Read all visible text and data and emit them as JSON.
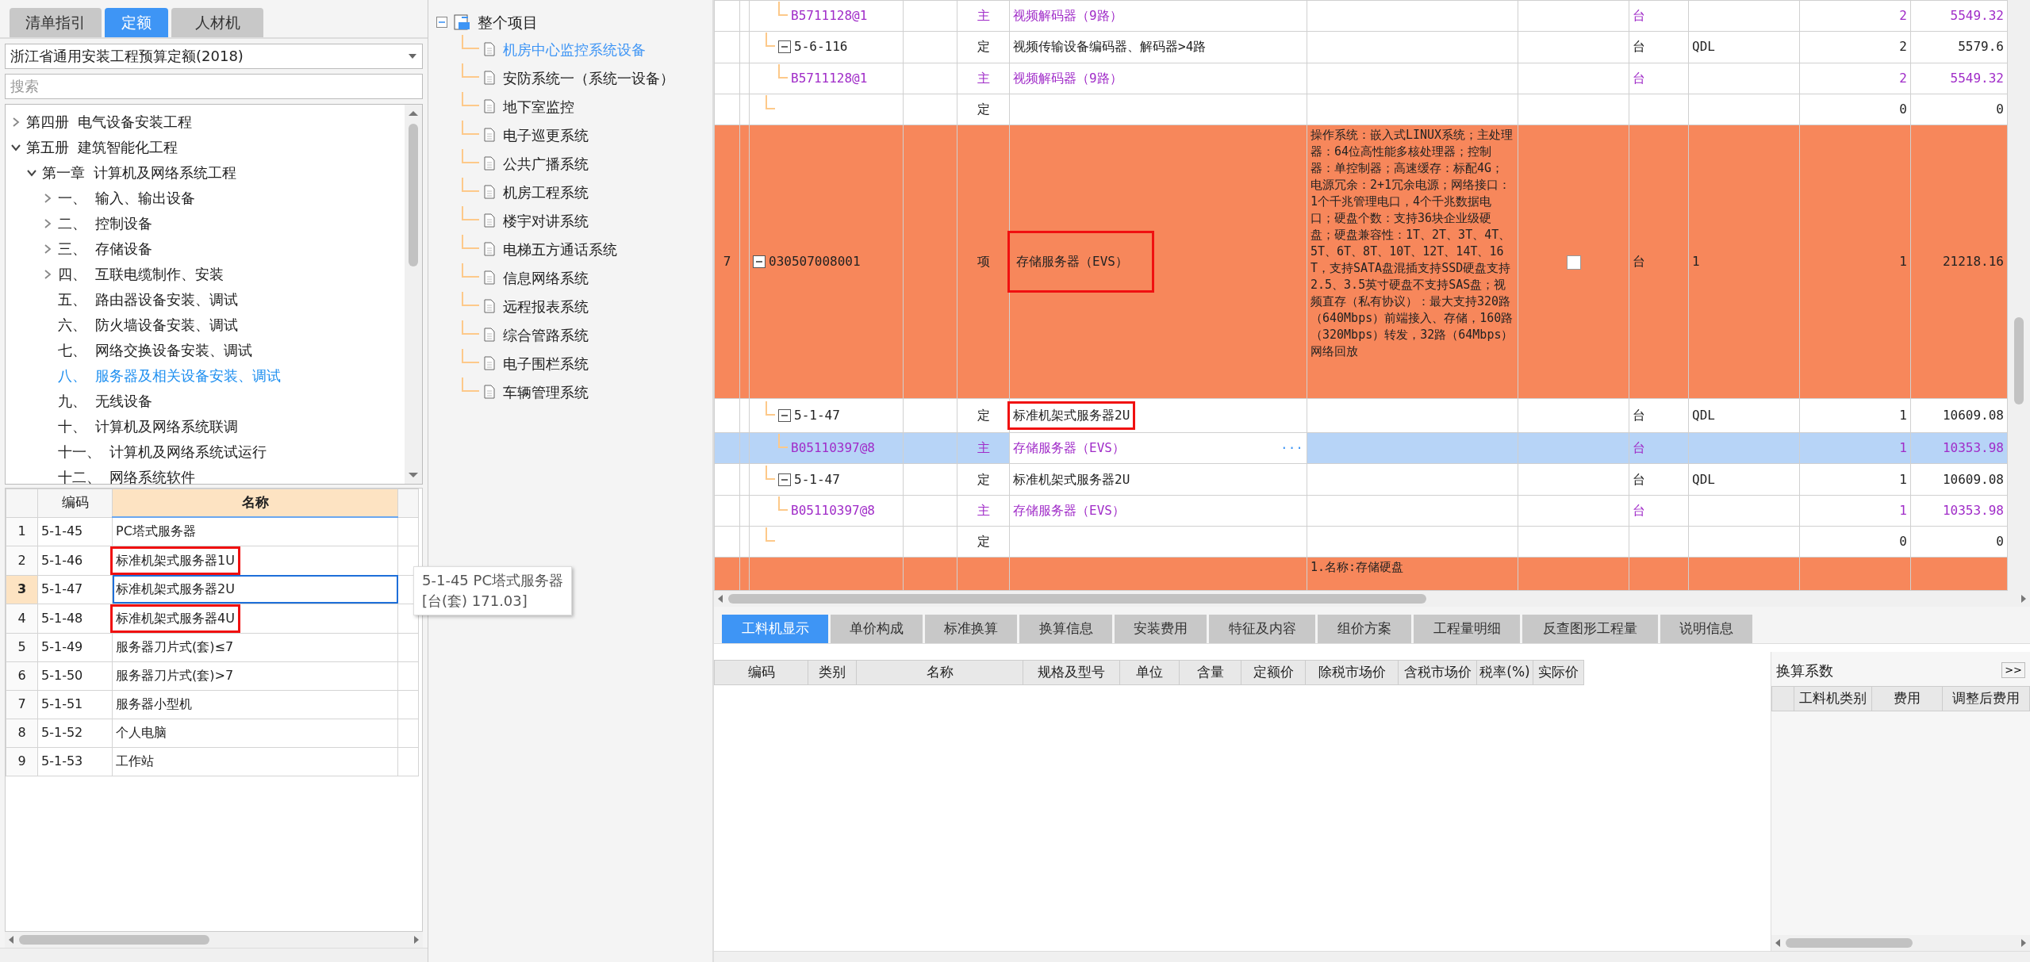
{
  "left_tabs": [
    {
      "label": "清单指引",
      "selected": false
    },
    {
      "label": "定额",
      "selected": true
    },
    {
      "label": "人材机",
      "selected": false
    }
  ],
  "quota_library": {
    "value": "浙江省通用安装工程预算定额(2018)"
  },
  "search": {
    "placeholder": "搜索"
  },
  "chapter_tree": [
    {
      "label": "第四册  电气设备安装工程",
      "kind": "group",
      "expanded": false,
      "selected": false
    },
    {
      "label": "第五册  建筑智能化工程",
      "kind": "group",
      "expanded": true,
      "selected": false,
      "children": [
        {
          "label": "第一章  计算机及网络系统工程",
          "kind": "group",
          "expanded": true,
          "selected": false,
          "children": [
            {
              "label": "一、  输入、输出设备",
              "kind": "group",
              "expanded": false,
              "selected": false
            },
            {
              "label": "二、  控制设备",
              "kind": "group",
              "expanded": false,
              "selected": false
            },
            {
              "label": "三、  存储设备",
              "kind": "group",
              "expanded": false,
              "selected": false
            },
            {
              "label": "四、  互联电缆制作、安装",
              "kind": "group",
              "expanded": false,
              "selected": false
            },
            {
              "label": "五、  路由器设备安装、调试",
              "kind": "leaf",
              "selected": false
            },
            {
              "label": "六、  防火墙设备安装、调试",
              "kind": "leaf",
              "selected": false
            },
            {
              "label": "七、  网络交换设备安装、调试",
              "kind": "leaf",
              "selected": false
            },
            {
              "label": "八、  服务器及相关设备安装、调试",
              "kind": "leaf",
              "selected": true
            },
            {
              "label": "九、  无线设备",
              "kind": "leaf",
              "selected": false
            },
            {
              "label": "十、  计算机及网络系统联调",
              "kind": "leaf",
              "selected": false
            },
            {
              "label": "十一、  计算机及网络系统试运行",
              "kind": "leaf",
              "selected": false
            },
            {
              "label": "十二、  网络系统软件",
              "kind": "leaf",
              "selected": false
            }
          ]
        }
      ]
    }
  ],
  "quota_grid": {
    "columns": [
      {
        "label": "编码",
        "selected": false
      },
      {
        "label": "名称",
        "selected": true
      }
    ],
    "rows": [
      {
        "no": "1",
        "code": "5-1-45",
        "name": "PC塔式服务器",
        "selected": false,
        "marked": false
      },
      {
        "no": "2",
        "code": "5-1-46",
        "name": "标准机架式服务器1U",
        "selected": false,
        "marked": true
      },
      {
        "no": "3",
        "code": "5-1-47",
        "name": "标准机架式服务器2U",
        "selected": true,
        "marked": false
      },
      {
        "no": "4",
        "code": "5-1-48",
        "name": "标准机架式服务器4U",
        "selected": false,
        "marked": true
      },
      {
        "no": "5",
        "code": "5-1-49",
        "name": "服务器刀片式(套)≤7",
        "selected": false,
        "marked": false
      },
      {
        "no": "6",
        "code": "5-1-50",
        "name": "服务器刀片式(套)>7",
        "selected": false,
        "marked": false
      },
      {
        "no": "7",
        "code": "5-1-51",
        "name": "服务器小型机",
        "selected": false,
        "marked": false
      },
      {
        "no": "8",
        "code": "5-1-52",
        "name": "个人电脑",
        "selected": false,
        "marked": false
      },
      {
        "no": "9",
        "code": "5-1-53",
        "name": "工作站",
        "selected": false,
        "marked": false
      }
    ]
  },
  "tooltip": {
    "lines": [
      "5-1-45 PC塔式服务器",
      "[台(套) 171.03]"
    ]
  },
  "project_tree": {
    "label": "整个项目",
    "expanded": true,
    "children": [
      {
        "label": "机房中心监控系统设备",
        "selected": true
      },
      {
        "label": "安防系统一（系统一设备）",
        "selected": false
      },
      {
        "label": "地下室监控",
        "selected": false
      },
      {
        "label": "电子巡更系统",
        "selected": false
      },
      {
        "label": "公共广播系统",
        "selected": false
      },
      {
        "label": "机房工程系统",
        "selected": false
      },
      {
        "label": "楼宇对讲系统",
        "selected": false
      },
      {
        "label": "电梯五方通话系统",
        "selected": false
      },
      {
        "label": "信息网络系统",
        "selected": false
      },
      {
        "label": "远程报表系统",
        "selected": false
      },
      {
        "label": "综合管路系统",
        "selected": false
      },
      {
        "label": "电子围栏系统",
        "selected": false
      },
      {
        "label": "车辆管理系统",
        "selected": false
      }
    ]
  },
  "bill_grid": {
    "ellipsis_button": "···",
    "rows": [
      {
        "children": [
          {
            "children": [
              {
                "kind": "material",
                "code": "B5711128@1",
                "type": "主",
                "name": "视频解码器（9路）",
                "unit": "台",
                "quantity": "2",
                "amount": "5549.32",
                "selected": false,
                "marked": false
              }
            ]
          },
          {
            "kind": "quota",
            "code": "5-6-116",
            "type": "定",
            "name": "视频传输设备编码器、解码器>4路",
            "unit": "台",
            "column_8": "QDL",
            "quantity": "2",
            "amount": "5579.6",
            "expanded": true,
            "selected": false,
            "marked": false,
            "children": [
              {
                "kind": "material",
                "code": "B5711128@1",
                "type": "主",
                "name": "视频解码器（9路）",
                "unit": "台",
                "quantity": "2",
                "amount": "5549.32",
                "selected": false,
                "marked": false
              }
            ]
          },
          {
            "kind": "quota",
            "type": "定",
            "quantity": "0",
            "amount": "0",
            "selected": false,
            "marked": false
          }
        ]
      },
      {
        "kind": "item",
        "no": "7",
        "code": "030507008001",
        "type": "项",
        "name": "存储服务器（EVS）",
        "description": "操作系统：嵌入式LINUX系统；主处理器：64位高性能多核处理器；控制器：单控制器；高速缓存：标配4G；电源冗余：2+1冗余电源；网络接口：1个千兆管理电口，4个千兆数据电口；硬盘个数：支持36块企业级硬盘；硬盘兼容性：1T、2T、3T、4T、5T、6T、8T、10T、12T、14T、16T，支持SATA盘混插支持SSD硬盘支持2.5、3.5英寸硬盘不支持SAS盘；视频直存（私有协议）：最大支持320路（640Mbps）前端接入、存储，160路（320Mbps）转发，32路（64Mbps）网络回放",
        "checked": false,
        "unit": "台",
        "column_8": "1",
        "quantity": "1",
        "amount": "21218.16",
        "expanded": true,
        "selected": false,
        "marked": true,
        "children": [
          {
            "kind": "quota",
            "code": "5-1-47",
            "type": "定",
            "name": "标准机架式服务器2U",
            "unit": "台",
            "column_8": "QDL",
            "quantity": "1",
            "amount": "10609.08",
            "expanded": true,
            "selected": false,
            "marked": true,
            "children": [
              {
                "kind": "material",
                "code": "B05110397@8",
                "type": "主",
                "name": "存储服务器（EVS）",
                "unit": "台",
                "quantity": "1",
                "amount": "10353.98",
                "selected": true,
                "marked": false
              }
            ]
          },
          {
            "kind": "quota",
            "code": "5-1-47",
            "type": "定",
            "name": "标准机架式服务器2U",
            "unit": "台",
            "column_8": "QDL",
            "quantity": "1",
            "amount": "10609.08",
            "expanded": true,
            "selected": false,
            "marked": false,
            "children": [
              {
                "kind": "material",
                "code": "B05110397@8",
                "type": "主",
                "name": "存储服务器（EVS）",
                "unit": "台",
                "quantity": "1",
                "amount": "10353.98",
                "selected": false,
                "marked": false
              }
            ]
          },
          {
            "kind": "quota",
            "type": "定",
            "quantity": "0",
            "amount": "0",
            "selected": false,
            "marked": false
          }
        ]
      },
      {
        "kind": "item",
        "description": "1.名称:存储硬盘",
        "selected": false,
        "marked": false
      }
    ]
  },
  "detail_tabs": [
    {
      "label": "工料机显示",
      "selected": true
    },
    {
      "label": "单价构成",
      "selected": false
    },
    {
      "label": "标准换算",
      "selected": false
    },
    {
      "label": "换算信息",
      "selected": false
    },
    {
      "label": "安装费用",
      "selected": false
    },
    {
      "label": "特征及内容",
      "selected": false
    },
    {
      "label": "组价方案",
      "selected": false
    },
    {
      "label": "工程量明细",
      "selected": false
    },
    {
      "label": "反查图形工程量",
      "selected": false
    },
    {
      "label": "说明信息",
      "selected": false
    }
  ],
  "detail_grid": {
    "columns": [
      "编码",
      "类别",
      "名称",
      "规格及型号",
      "单位",
      "含量",
      "定额价",
      "除税市场价",
      "含税市场价",
      "税率(%)",
      "实际价"
    ]
  },
  "coefficient_panel": {
    "title": "换算系数",
    "toggle": ">>",
    "columns": [
      "工料机类别",
      "费用",
      "调整后费用"
    ]
  }
}
